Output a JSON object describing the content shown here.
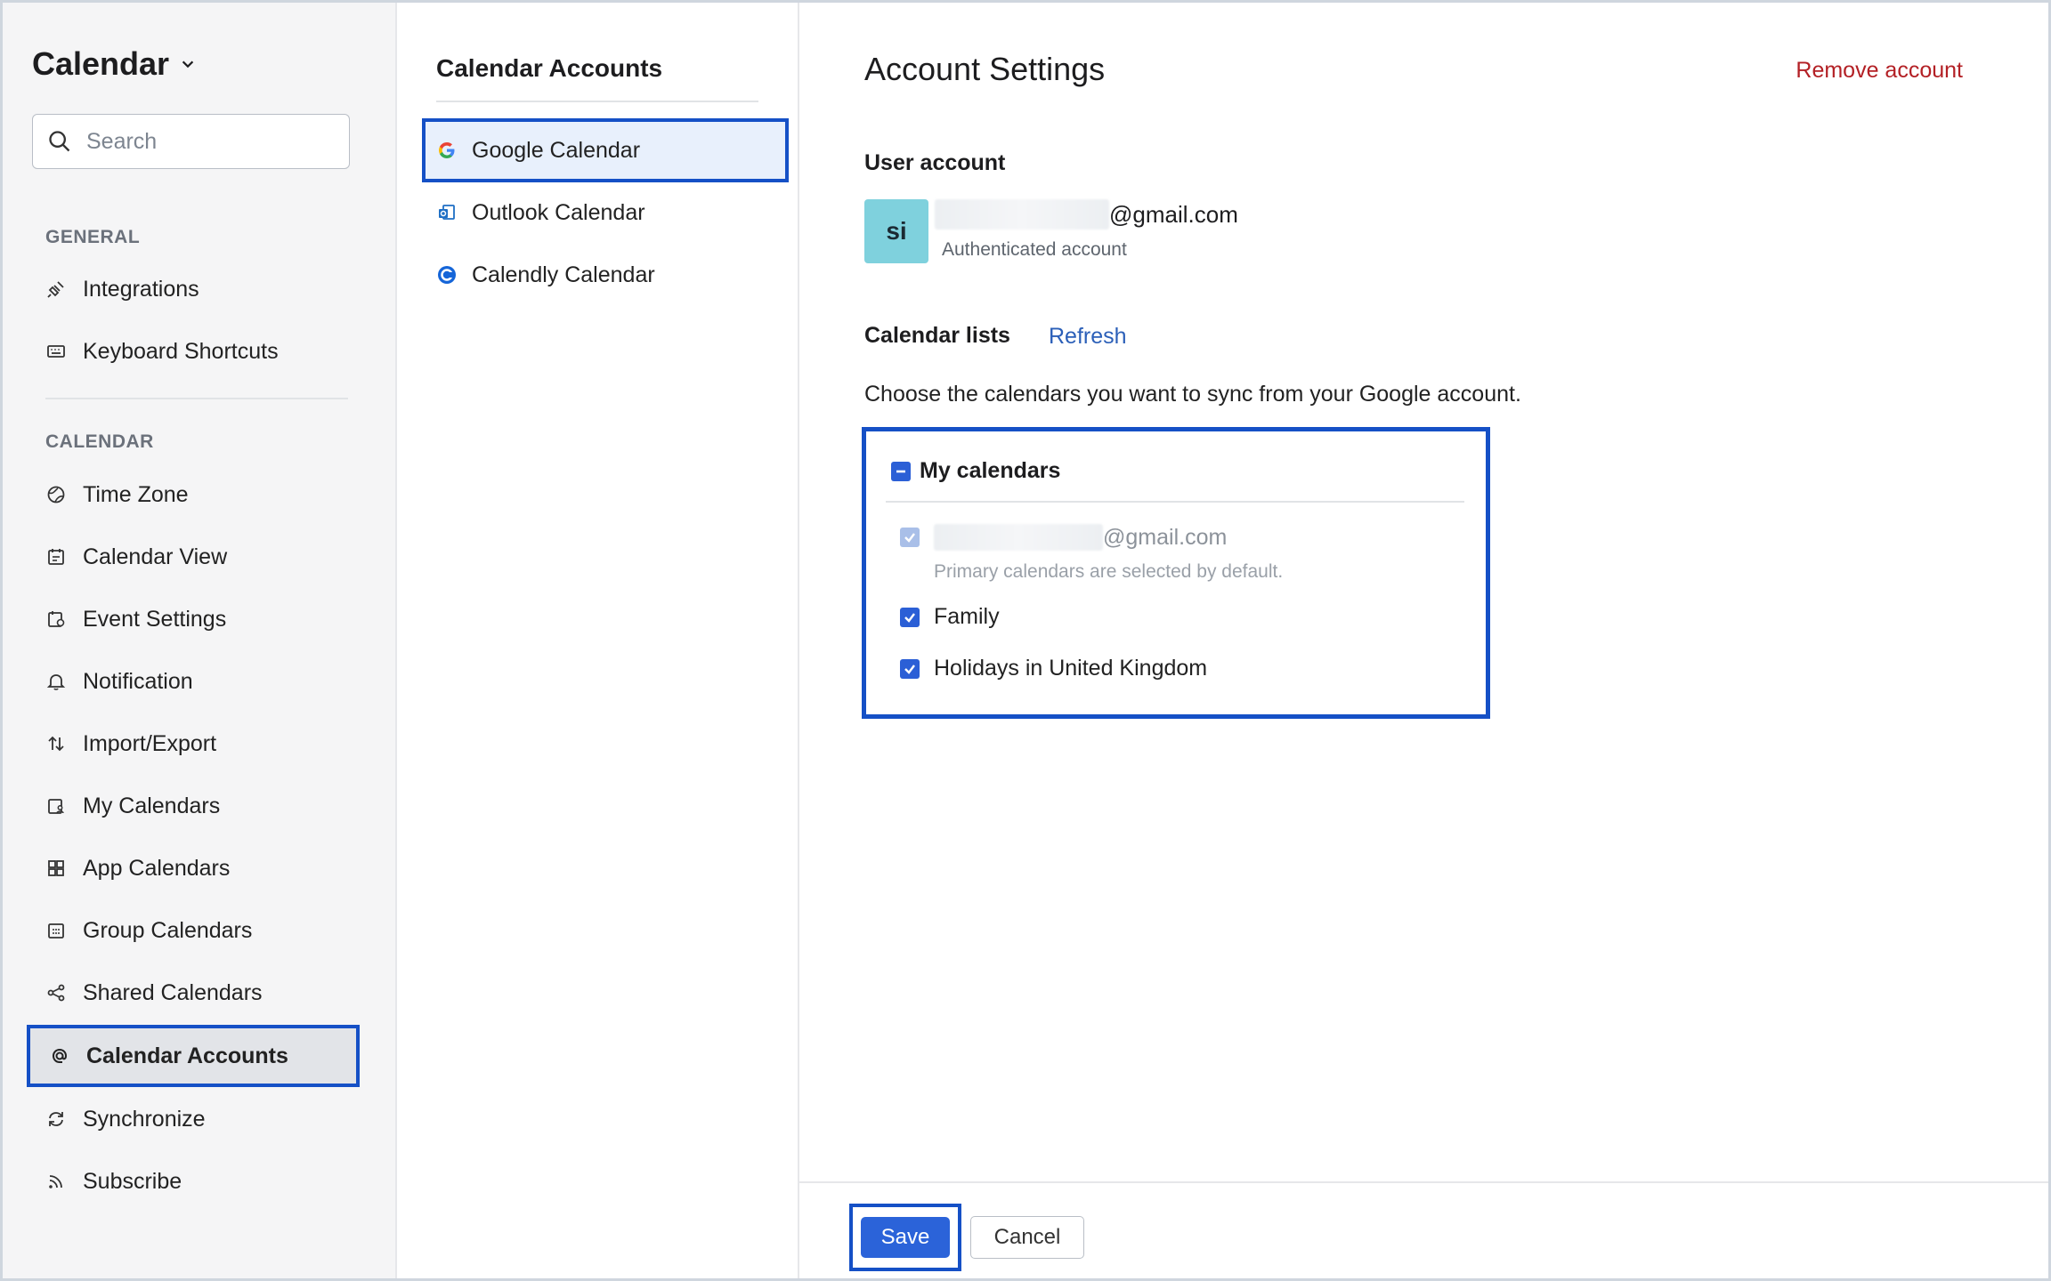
{
  "sidebar": {
    "app_title": "Calendar",
    "search_placeholder": "Search",
    "general_label": "GENERAL",
    "general_items": [
      {
        "label": "Integrations",
        "icon": "plug-icon"
      },
      {
        "label": "Keyboard Shortcuts",
        "icon": "keyboard-icon"
      }
    ],
    "calendar_label": "CALENDAR",
    "calendar_items": [
      {
        "label": "Time Zone",
        "icon": "globe-icon"
      },
      {
        "label": "Calendar View",
        "icon": "calendar-view-icon"
      },
      {
        "label": "Event Settings",
        "icon": "event-settings-icon"
      },
      {
        "label": "Notification",
        "icon": "bell-icon"
      },
      {
        "label": "Import/Export",
        "icon": "import-export-icon"
      },
      {
        "label": "My Calendars",
        "icon": "my-calendars-icon"
      },
      {
        "label": "App Calendars",
        "icon": "app-calendars-icon"
      },
      {
        "label": "Group Calendars",
        "icon": "group-calendars-icon"
      },
      {
        "label": "Shared Calendars",
        "icon": "share-icon"
      },
      {
        "label": "Calendar Accounts",
        "icon": "at-icon",
        "active": true
      },
      {
        "label": "Synchronize",
        "icon": "sync-icon"
      },
      {
        "label": "Subscribe",
        "icon": "rss-icon"
      }
    ]
  },
  "accounts_panel": {
    "title": "Calendar Accounts",
    "items": [
      {
        "label": "Google Calendar",
        "icon": "google-icon",
        "active": true
      },
      {
        "label": "Outlook Calendar",
        "icon": "outlook-icon"
      },
      {
        "label": "Calendly Calendar",
        "icon": "calendly-icon"
      }
    ]
  },
  "settings": {
    "title": "Account Settings",
    "remove_label": "Remove account",
    "user_account_label": "User account",
    "avatar_initials": "si",
    "email_suffix": "@gmail.com",
    "auth_status": "Authenticated account",
    "calendar_lists_label": "Calendar lists",
    "refresh_label": "Refresh",
    "choose_text": "Choose the calendars you want to sync from your Google account.",
    "group_label": "My calendars",
    "primary_email_suffix": "@gmail.com",
    "primary_note": "Primary calendars are selected by default.",
    "calendars": [
      "Family",
      "Holidays in United Kingdom"
    ]
  },
  "footer": {
    "save_label": "Save",
    "cancel_label": "Cancel"
  },
  "colors": {
    "accent": "#2b63d9",
    "highlight_border": "#1550c6",
    "danger": "#b32025",
    "avatar_bg": "#7fd1dd"
  }
}
